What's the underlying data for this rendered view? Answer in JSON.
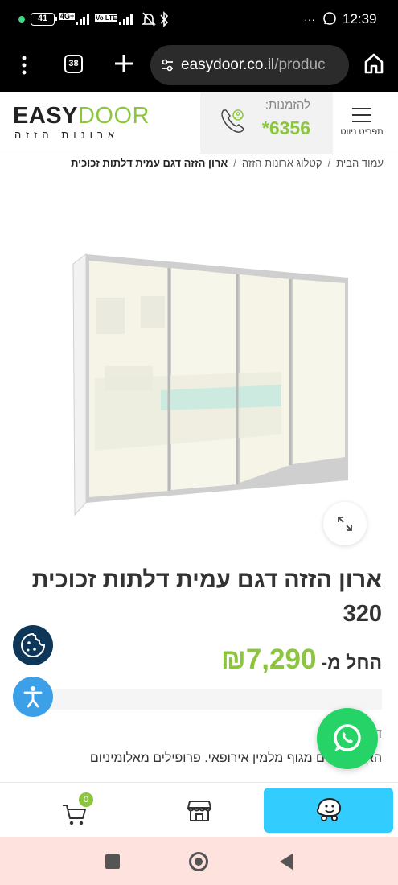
{
  "status_bar": {
    "battery": "41",
    "net1_top": "4G+",
    "net1_bottom": "Vo LTE",
    "net2": "Vo LTE",
    "time": "12:39",
    "overflow": "···"
  },
  "browser": {
    "tab_count": "38",
    "url_domain": "easydoor.co.il",
    "url_path": "/produc",
    "icons": [
      "menu-dots-icon",
      "tabs-icon",
      "new-tab-icon",
      "site-settings-icon",
      "home-icon"
    ]
  },
  "header": {
    "logo_easy": "EASY",
    "logo_door": "DOOR",
    "logo_sub": "ארונות הזזה",
    "order_label": "להזמנות:",
    "order_number": "*6356",
    "nav_label": "תפריט ניווט"
  },
  "breadcrumb": {
    "items": [
      "עמוד הבית",
      "קטלוג ארונות הזזה",
      "ארון הזזה דגם עמית דלתות זכוכית"
    ]
  },
  "product": {
    "title": "ארון הזזה דגם עמית דלתות זכוכית 320",
    "price_prefix": "החל מ-",
    "price": "7,290",
    "currency": "₪",
    "desc_line1": "ד... זכוכית.",
    "desc_line2": "הא... עשויים מגוף מלמין אירופאי. פרופילים מאלומיניום"
  },
  "bottom_bar": {
    "cart_count": "0"
  },
  "colors": {
    "brand_green": "#8cc63f",
    "whatsapp": "#25d366",
    "waze": "#33ccff",
    "cookie": "#0d3659",
    "accessibility": "#3ca0e8"
  }
}
